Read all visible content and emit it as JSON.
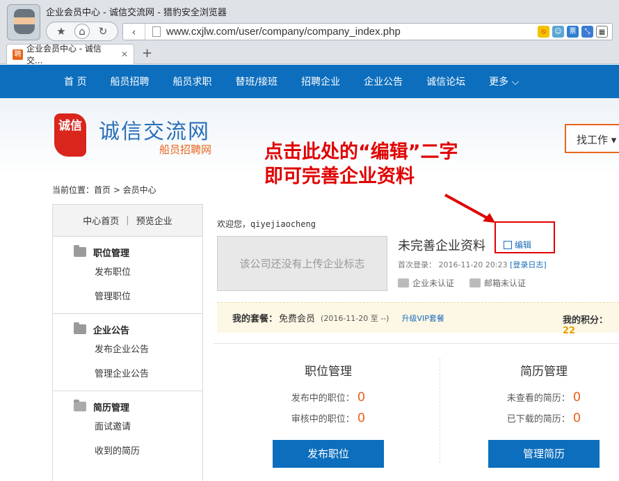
{
  "browser": {
    "window_title": "企业会员中心 - 诚信交流网 - 猎豹安全浏览器",
    "url": "www.cxjlw.com/user/company/company_index.php",
    "tab_title": "企业会员中心 - 诚信交...",
    "tab_favicon": "聘"
  },
  "topnav": {
    "items": [
      "首 页",
      "船员招聘",
      "船员求职",
      "替班/接班",
      "招聘企业",
      "企业公告",
      "诚信论坛",
      "更多 ⌵"
    ]
  },
  "header": {
    "seal_text": "诚信",
    "logo_main": "诚信交流网",
    "logo_sub": "船员招聘网",
    "find_job": "找工作 ▾"
  },
  "annotation": {
    "text": "点击此处的“编辑”二字\n即可完善企业资料",
    "color": "#e00000"
  },
  "breadcrumb": "当前位置：首页 > 会员中心",
  "sidebar": {
    "top_links": [
      "中心首页",
      "预览企业"
    ],
    "groups": [
      {
        "title": "职位管理",
        "items": [
          "发布职位",
          "管理职位"
        ]
      },
      {
        "title": "企业公告",
        "items": [
          "发布企业公告",
          "管理企业公告"
        ]
      },
      {
        "title": "简历管理",
        "items": [
          "面试邀请",
          "收到的简历"
        ]
      }
    ]
  },
  "main": {
    "welcome_prefix": "欢迎您，",
    "username": "qiyejiaocheng",
    "no_logo": "该公司还没有上传企业标志",
    "company_name": "未完善企业资料",
    "edit": "编辑",
    "last_login_label": "首次登录：",
    "last_login_time": "2016-11-20 20:23",
    "login_log": "[登录日志]",
    "verify_company": "企业未认证",
    "verify_email": "邮箱未认证",
    "plan_label": "我的套餐：",
    "plan_value": "免费会员",
    "plan_date": "(2016-11-20 至 --)",
    "upgrade": "升级VIP套餐",
    "points_label": "我的积分：",
    "points_value": "22",
    "jobs_panel": {
      "title": "职位管理",
      "row1_label": "发布中的职位：",
      "row1_value": "0",
      "row2_label": "审核中的职位：",
      "row2_value": "0",
      "button": "发布职位"
    },
    "resume_panel": {
      "title": "简历管理",
      "row1_label": "未查看的简历：",
      "row1_value": "0",
      "row2_label": "已下载的简历：",
      "row2_value": "0",
      "button": "管理简历"
    }
  }
}
